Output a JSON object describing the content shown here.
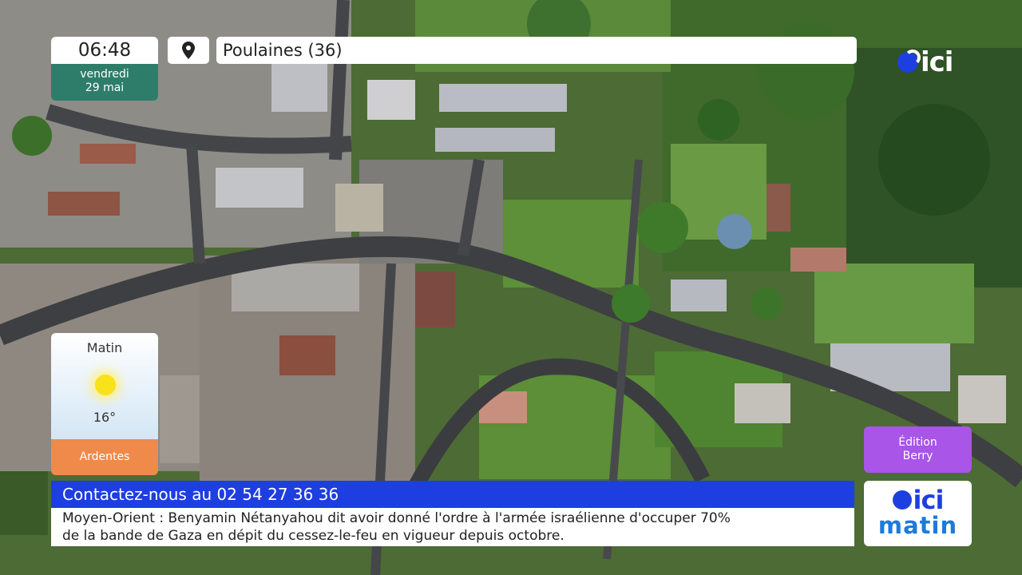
{
  "clock": {
    "time": "06:48",
    "day": "vendredi",
    "date": "29 mai"
  },
  "location": {
    "icon": "location-pin-icon",
    "name": "Poulaines (36)"
  },
  "brand": {
    "logo_text": "ici",
    "logo_color": "#1e3fe0"
  },
  "weather": {
    "period": "Matin",
    "icon": "sun-icon",
    "temperature": "16°",
    "city": "Ardentes"
  },
  "edition": {
    "line1": "Édition",
    "line2": "Berry"
  },
  "ticker": {
    "contact": "Contactez-nous au 02 54 27 36 36",
    "headline_line1": "Moyen-Orient : Benyamin Nétanyahou dit avoir donné l'ordre à l'armée israélienne d'occuper 70%",
    "headline_line2": "de la bande de Gaza en dépit du cessez-le-feu en vigueur depuis octobre."
  },
  "program_logo": {
    "brand": "ici",
    "show": "matin"
  },
  "colors": {
    "accent_blue": "#1d3ee0",
    "clock_green": "#2e7d6a",
    "weather_orange": "#f08a4b",
    "edition_purple": "#a855e8"
  }
}
